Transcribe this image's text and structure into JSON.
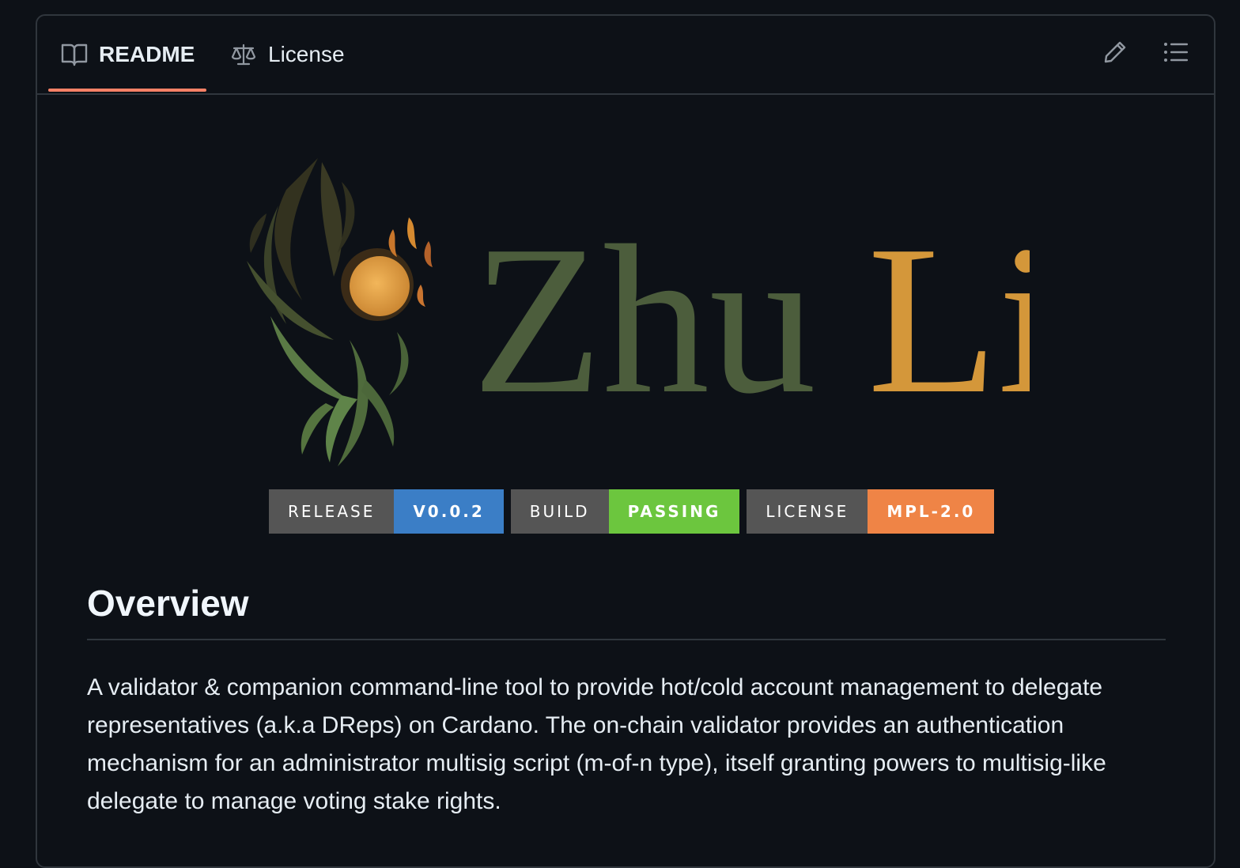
{
  "tabs": [
    {
      "label": "README",
      "icon": "book-icon",
      "active": true
    },
    {
      "label": "License",
      "icon": "law-scale-icon",
      "active": false
    }
  ],
  "toolbar": {
    "edit_icon": "pencil-icon",
    "outline_icon": "list-unordered-icon"
  },
  "logo": {
    "text_part1": "Zhu",
    "text_part2": "Li",
    "colors": {
      "green": "#4c5d3c",
      "gold": "#d4973a"
    }
  },
  "badges": [
    {
      "key": "RELEASE",
      "value": "V0.0.2",
      "color": "#3b7ec6"
    },
    {
      "key": "BUILD",
      "value": "PASSING",
      "color": "#6cc63e"
    },
    {
      "key": "LICENSE",
      "value": "MPL-2.0",
      "color": "#ef8446"
    }
  ],
  "readme": {
    "heading": "Overview",
    "paragraph": "A validator & companion command-line tool to provide hot/cold account management to delegate representatives (a.k.a DReps) on Cardano. The on-chain validator provides an authentication mechanism for an administrator multisig script (m-of-n type), itself granting powers to multisig-like delegate to manage voting stake rights."
  },
  "colors": {
    "background": "#0d1117",
    "border": "#30363d",
    "active_tab_underline": "#f78166",
    "text": "#e6edf3"
  }
}
